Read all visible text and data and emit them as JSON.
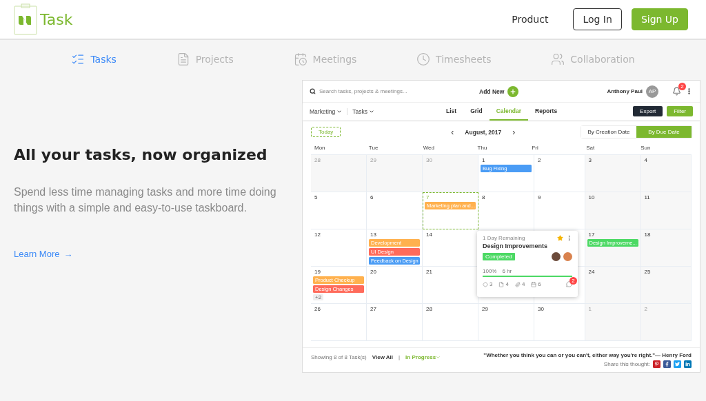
{
  "header": {
    "logo": "Task",
    "nav": [
      {
        "label": "Product",
        "kind": "link"
      },
      {
        "label": "Log In",
        "kind": "outline"
      },
      {
        "label": "Sign Up",
        "kind": "primary"
      }
    ]
  },
  "features": [
    {
      "label": "Tasks",
      "selected": true
    },
    {
      "label": "Projects",
      "selected": false
    },
    {
      "label": "Meetings",
      "selected": false
    },
    {
      "label": "Timesheets",
      "selected": false
    },
    {
      "label": "Collaboration",
      "selected": false
    }
  ],
  "hero": {
    "title": "All your tasks, now organized",
    "text": "Spend less time managing tasks and more time doing things with a simple and easy-to-use taskboard.",
    "link": "Learn More",
    "link_arrow": "→"
  },
  "app": {
    "search": {
      "placeholder": "Search tasks, projects & meetings..."
    },
    "add_new": "Add New",
    "user": {
      "name": "Anthony Paul",
      "initials": "AP"
    },
    "notifications": "2",
    "filters": [
      {
        "label": "Marketing"
      },
      {
        "label": "Tasks"
      }
    ],
    "views": [
      {
        "label": "List",
        "selected": false
      },
      {
        "label": "Grid",
        "selected": false
      },
      {
        "label": "Calendar",
        "selected": true
      },
      {
        "label": "Reports",
        "selected": false
      }
    ],
    "actions": [
      {
        "label": "Export",
        "kind": "dark"
      },
      {
        "label": "Filter",
        "kind": "primary"
      }
    ],
    "today": "Today",
    "month": "August, 2017",
    "prev": "‹",
    "next": "›",
    "sort": [
      {
        "label": "By Creation Date",
        "selected": false
      },
      {
        "label": "By Due Date",
        "selected": true
      }
    ],
    "weekdays": [
      "Mon",
      "Tue",
      "Wed",
      "Thu",
      "Fri",
      "Sat",
      "Sun"
    ],
    "weeks": [
      [
        {
          "day": "28",
          "other_month": true
        },
        {
          "day": "29",
          "other_month": true
        },
        {
          "day": "30",
          "other_month": true
        },
        {
          "day": "1",
          "other_month": false,
          "events": [
            {
              "title": "Bug Fixing",
              "color": "#4a9cf5"
            }
          ]
        },
        {
          "day": "2",
          "other_month": false
        },
        {
          "day": "3",
          "other_month": false
        },
        {
          "day": "4",
          "other_month": false
        }
      ],
      [
        {
          "day": "5",
          "other_month": false
        },
        {
          "day": "6",
          "other_month": false
        },
        {
          "day": "7",
          "other_month": false,
          "today": true,
          "events": [
            {
              "title": "Marketing plan and...",
              "color": "#ffb14e"
            }
          ]
        },
        {
          "day": "8",
          "other_month": false
        },
        {
          "day": "9",
          "other_month": false
        },
        {
          "day": "10",
          "other_month": false
        },
        {
          "day": "11",
          "other_month": false
        }
      ],
      [
        {
          "day": "12",
          "other_month": false
        },
        {
          "day": "13",
          "other_month": false,
          "events": [
            {
              "title": "Development",
              "color": "#ffb14e"
            },
            {
              "title": "UI Design",
              "color": "#ff6b5b"
            },
            {
              "title": "Feedback on Design",
              "color": "#4a9cf5"
            }
          ]
        },
        {
          "day": "14",
          "other_month": false
        },
        {
          "covered": true
        },
        {
          "covered": true
        },
        {
          "day": "17",
          "other_month": false,
          "events": [
            {
              "title": "Design Improveme...",
              "color": "#4cd964"
            }
          ]
        },
        {
          "day": "18",
          "other_month": false
        }
      ],
      [
        {
          "day": "19",
          "other_month": false,
          "events": [
            {
              "title": "Product Checkup",
              "color": "#ffb14e"
            },
            {
              "title": "Design Changes",
              "color": "#ff6b5b"
            }
          ],
          "more": "+2"
        },
        {
          "day": "20",
          "other_month": false
        },
        {
          "day": "21",
          "other_month": false
        },
        {
          "covered": true
        },
        {
          "covered": true
        },
        {
          "day": "24",
          "other_month": false
        },
        {
          "day": "25",
          "other_month": false
        }
      ],
      [
        {
          "day": "26",
          "other_month": false
        },
        {
          "day": "27",
          "other_month": false
        },
        {
          "day": "28",
          "other_month": false
        },
        {
          "day": "29",
          "other_month": false
        },
        {
          "day": "30",
          "other_month": false
        },
        {
          "day": "1",
          "other_month": true
        },
        {
          "day": "2",
          "other_month": true
        }
      ]
    ],
    "card": {
      "remaining": "1 Day Remaining",
      "title": "Design Improvements",
      "status": "Completed",
      "starred": true,
      "percent": "100%",
      "hours": "6 hr",
      "level": 1,
      "stats": [
        "3",
        "4",
        "4",
        "6"
      ],
      "comments_badge": "2"
    },
    "footer": {
      "showing": "Showing 8 of 8 Task(s)",
      "view_all": "View All",
      "separator": "|",
      "in_progress": "In Progress",
      "quote": "\"Whether you think you can or you can't, either way you're right.\"— Henry Ford",
      "share": "Share this thought:"
    }
  }
}
